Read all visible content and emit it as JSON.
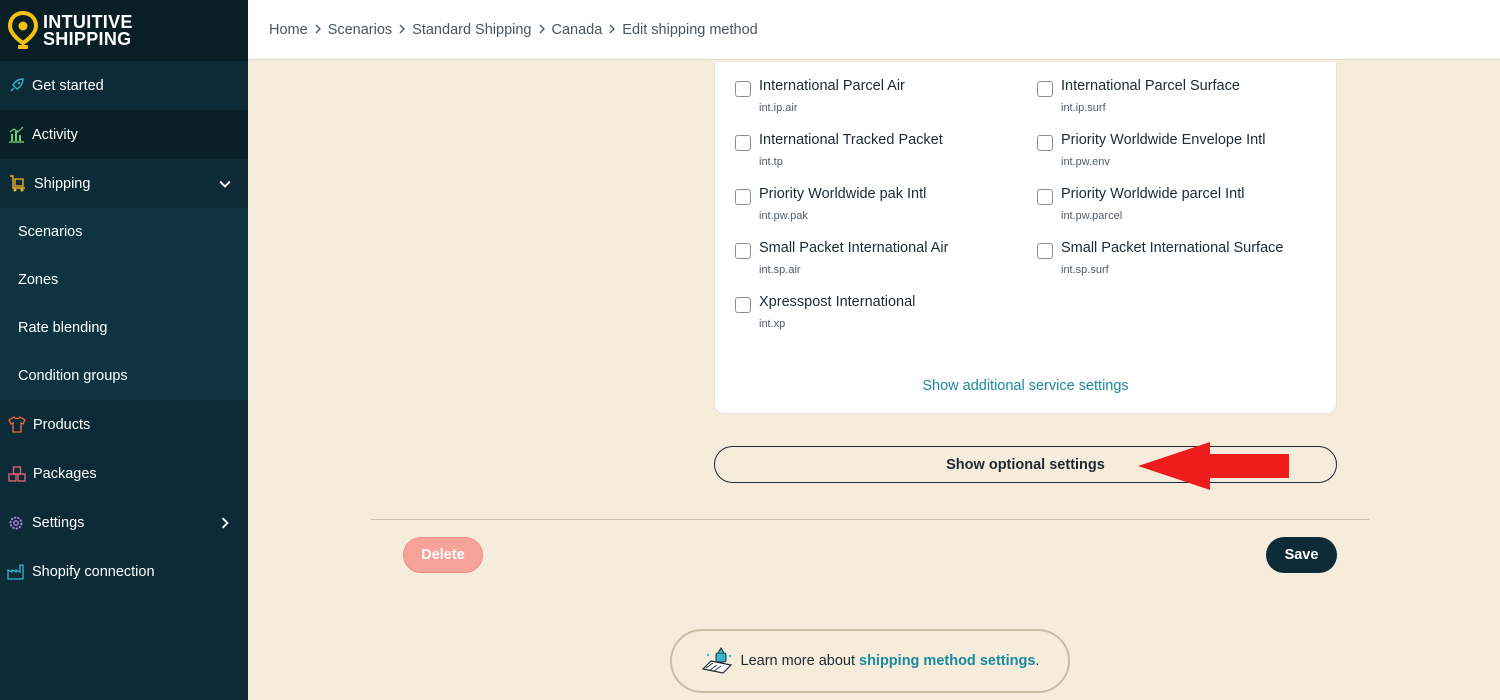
{
  "brand": {
    "line1": "INTUITIVE",
    "line2": "SHIPPING",
    "accent": "#f4c20d"
  },
  "sidebar": {
    "items": [
      {
        "label": "Get started",
        "icon": "rocket-icon"
      },
      {
        "label": "Activity",
        "icon": "chart-icon"
      },
      {
        "label": "Shipping",
        "icon": "truck-icon"
      },
      {
        "label": "Products",
        "icon": "shirt-icon"
      },
      {
        "label": "Packages",
        "icon": "boxes-icon"
      },
      {
        "label": "Settings",
        "icon": "gear-icon"
      },
      {
        "label": "Shopify connection",
        "icon": "factory-icon"
      }
    ],
    "shipping_sub": [
      "Scenarios",
      "Zones",
      "Rate blending",
      "Condition groups"
    ]
  },
  "breadcrumb": [
    "Home",
    "Scenarios",
    "Standard Shipping",
    "Canada",
    "Edit shipping method"
  ],
  "services": [
    {
      "name": "International Parcel Air",
      "code": "int.ip.air"
    },
    {
      "name": "International Parcel Surface",
      "code": "int.ip.surf"
    },
    {
      "name": "International Tracked Packet",
      "code": "int.tp"
    },
    {
      "name": "Priority Worldwide Envelope Intl",
      "code": "int.pw.env"
    },
    {
      "name": "Priority Worldwide pak Intl",
      "code": "int.pw.pak"
    },
    {
      "name": "Priority Worldwide parcel Intl",
      "code": "int.pw.parcel"
    },
    {
      "name": "Small Packet International Air",
      "code": "int.sp.air"
    },
    {
      "name": "Small Packet International Surface",
      "code": "int.sp.surf"
    },
    {
      "name": "Xpresspost International",
      "code": "int.xp"
    }
  ],
  "card": {
    "additional_link": "Show additional service settings"
  },
  "optional_button": "Show optional settings",
  "actions": {
    "delete": "Delete",
    "save": "Save"
  },
  "learn": {
    "text": "Learn more about",
    "link": "shipping method settings",
    "suffix": "."
  },
  "colors": {
    "sidebar": "#0c2b36",
    "background": "#f6ecdc",
    "link": "#1a8a9e",
    "arrow": "#ee1c1c",
    "delete": "#f7a39a"
  }
}
